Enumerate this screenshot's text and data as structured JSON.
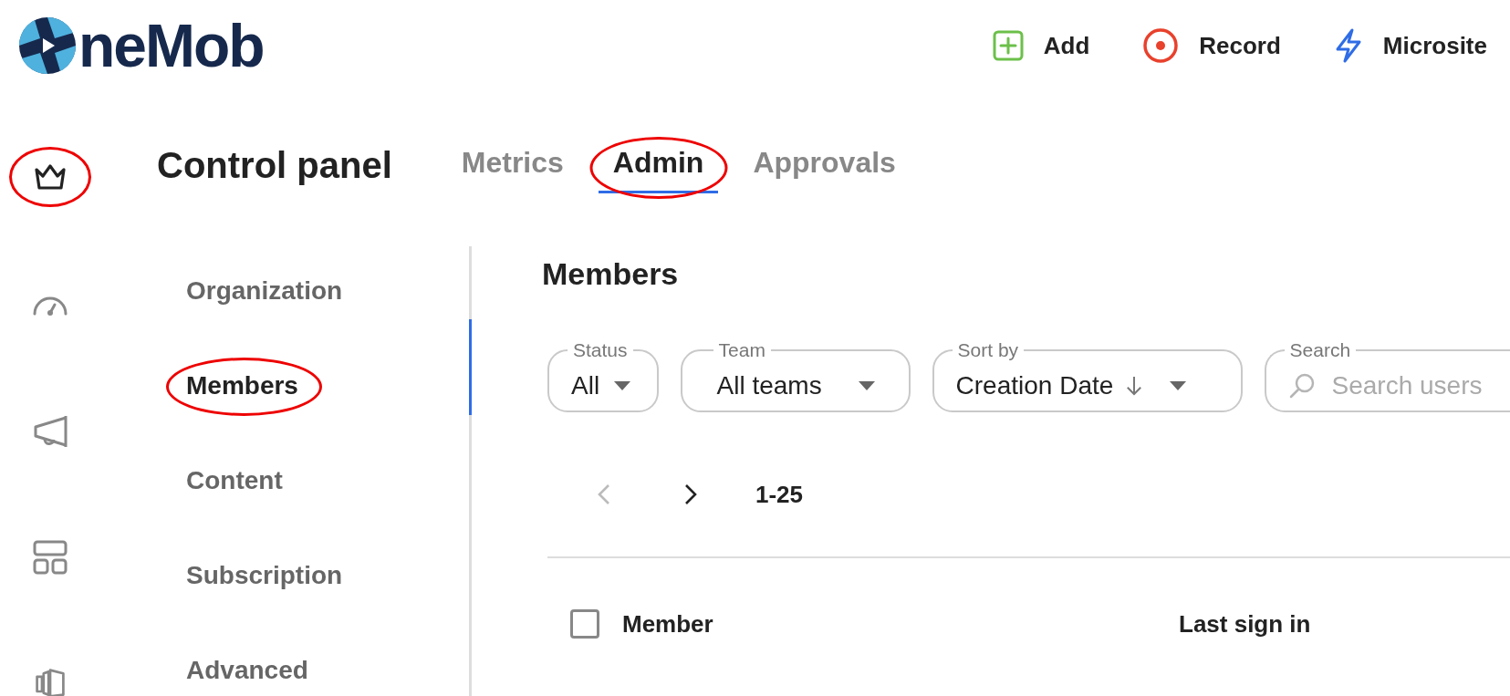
{
  "logo": {
    "text": "neMob"
  },
  "top_actions": [
    {
      "kind": "add",
      "label": "Add"
    },
    {
      "kind": "record",
      "label": "Record"
    },
    {
      "kind": "microsite",
      "label": "Microsite"
    }
  ],
  "rail": [
    {
      "kind": "crown",
      "selected": true,
      "highlighted": true
    },
    {
      "kind": "gauge",
      "selected": false,
      "highlighted": false
    },
    {
      "kind": "megaphone",
      "selected": false,
      "highlighted": false
    },
    {
      "kind": "layout",
      "selected": false,
      "highlighted": false
    },
    {
      "kind": "cards",
      "selected": false,
      "highlighted": false
    }
  ],
  "header": {
    "title": "Control panel",
    "tabs": [
      {
        "label": "Metrics",
        "selected": false,
        "highlighted": false
      },
      {
        "label": "Admin",
        "selected": true,
        "highlighted": true
      },
      {
        "label": "Approvals",
        "selected": false,
        "highlighted": false
      }
    ]
  },
  "subnav": [
    {
      "label": "Organization",
      "selected": false,
      "highlighted": false
    },
    {
      "label": "Members",
      "selected": true,
      "highlighted": true
    },
    {
      "label": "Content",
      "selected": false,
      "highlighted": false
    },
    {
      "label": "Subscription",
      "selected": false,
      "highlighted": false
    },
    {
      "label": "Advanced",
      "selected": false,
      "highlighted": false
    }
  ],
  "section_title": "Members",
  "filters": [
    {
      "kind": "select",
      "label": "Status",
      "value": "All"
    },
    {
      "kind": "select",
      "label": "Team",
      "value": "All teams"
    },
    {
      "kind": "sort",
      "label": "Sort by",
      "value": "Creation Date"
    },
    {
      "kind": "search",
      "label": "Search",
      "placeholder": "Search users"
    }
  ],
  "pagination": {
    "prev_disabled": true,
    "next_disabled": false,
    "range": "1-25"
  },
  "table": {
    "select_all_checked": false,
    "columns": [
      "Member",
      "Last sign in"
    ]
  }
}
